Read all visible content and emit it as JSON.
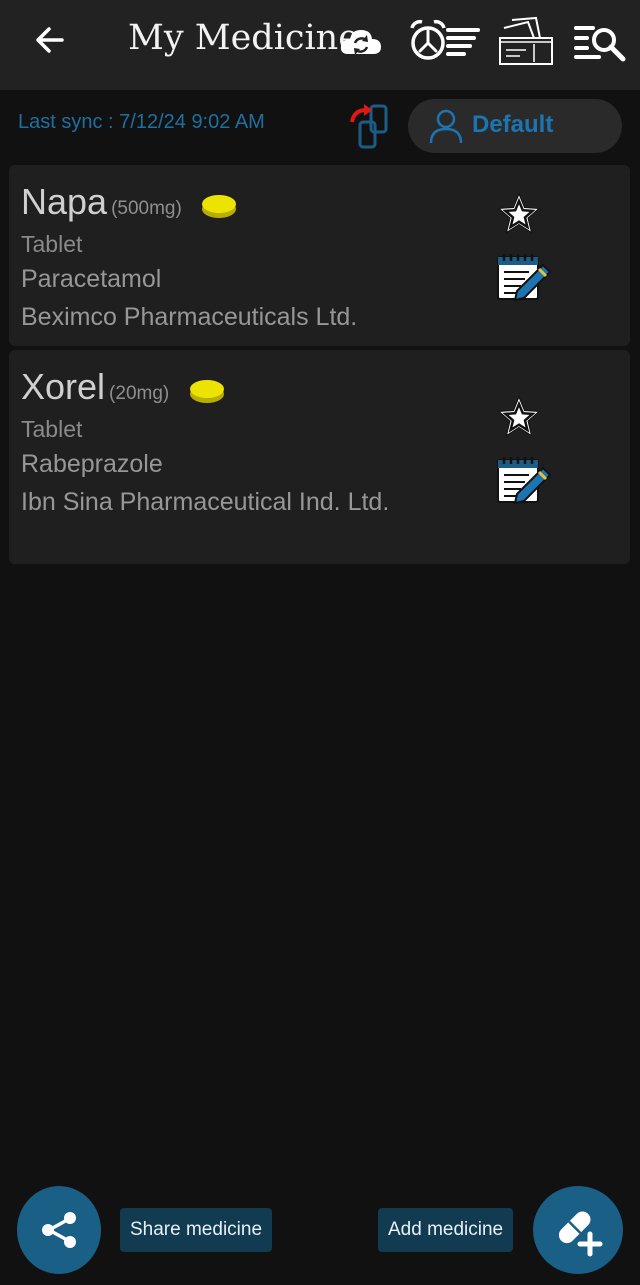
{
  "header": {
    "title": "My Medicine"
  },
  "sync": {
    "label": "Last sync : 7/12/24 9:02 AM"
  },
  "profile": {
    "name": "Default"
  },
  "medicines": [
    {
      "name": "Napa",
      "strength": "(500mg)",
      "form": "Tablet",
      "generic": "Paracetamol",
      "company": "Beximco Pharmaceuticals Ltd."
    },
    {
      "name": "Xorel",
      "strength": "(20mg)",
      "form": "Tablet",
      "generic": "Rabeprazole",
      "company": "Ibn Sina Pharmaceutical Ind. Ltd."
    }
  ],
  "actions": {
    "share_label": "Share medicine",
    "add_label": "Add medicine"
  },
  "colors": {
    "background": "#111111",
    "appbar": "#222222",
    "card": "#1f1f1f",
    "accent_blue": "#1d74b0",
    "fab": "#1a5f86",
    "chip": "#123b52",
    "pill_yellow": "#e8e100"
  },
  "icons": {
    "back": "back-arrow-icon",
    "cloud_sync": "cloud-sync-icon",
    "alarm_list": "alarm-list-icon",
    "wallet": "wallet-icon",
    "search_list": "search-list-icon",
    "switch": "switch-profile-icon",
    "profile": "user-icon",
    "pill": "pill-icon",
    "favorite": "star-icon",
    "note": "note-edit-icon",
    "share": "share-icon",
    "add_medicine": "add-capsule-icon"
  }
}
